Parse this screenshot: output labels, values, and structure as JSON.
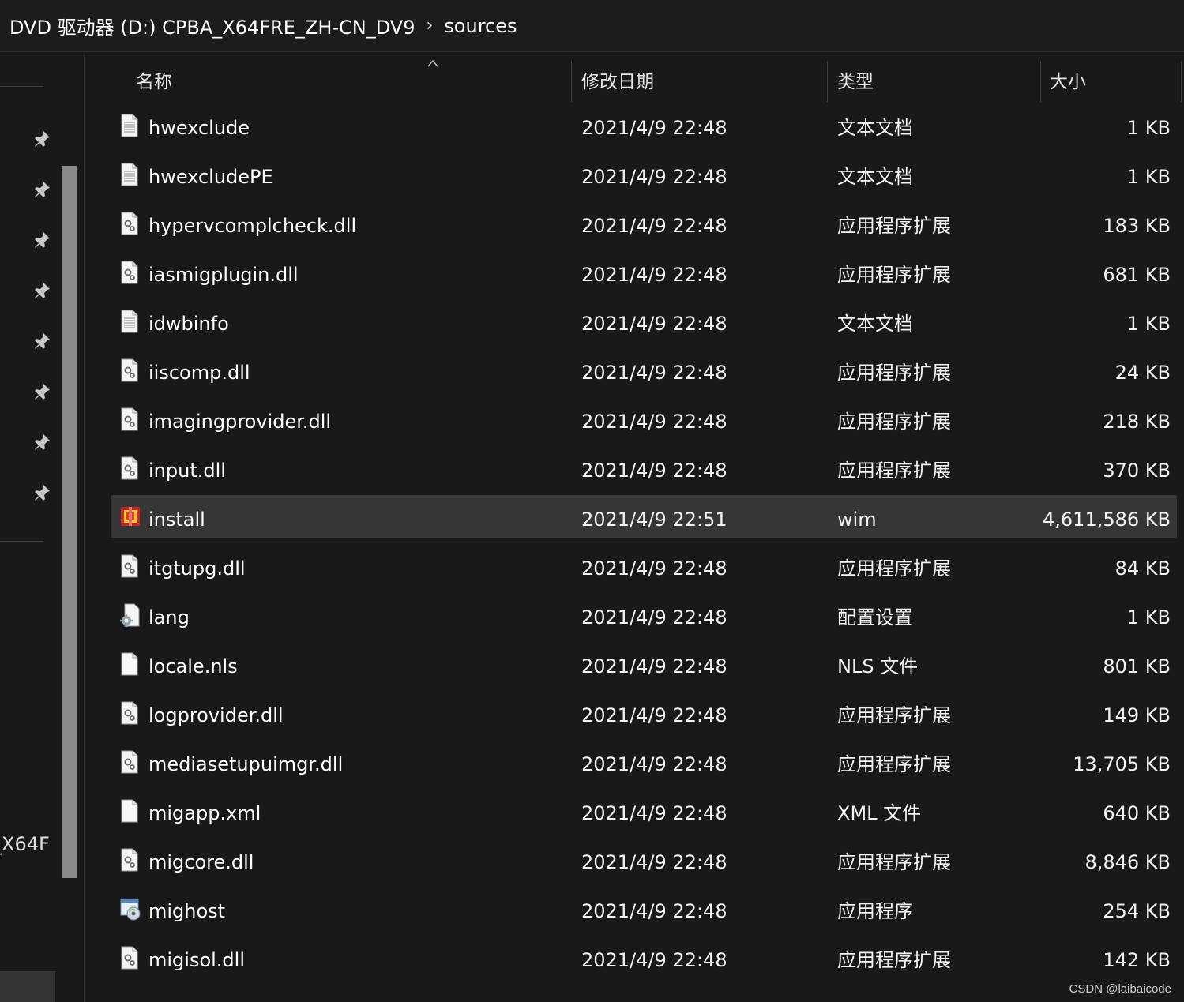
{
  "breadcrumb": {
    "drive": "DVD 驱动器 (D:) CPBA_X64FRE_ZH-CN_DV9",
    "separator": "›",
    "folder": "sources"
  },
  "nav_pane": {
    "pinned_icon": "pin-icon",
    "pinned_count": 8,
    "truncated_label": "_X64F"
  },
  "columns": {
    "name": "名称",
    "date": "修改日期",
    "type": "类型",
    "size": "大小",
    "sort_icon": "sort-ascending-icon"
  },
  "files": [
    {
      "name": "hwexclude",
      "date": "2021/4/9 22:48",
      "type": "文本文档",
      "size": "1 KB",
      "icon": "text-document-icon",
      "selected": false
    },
    {
      "name": "hwexcludePE",
      "date": "2021/4/9 22:48",
      "type": "文本文档",
      "size": "1 KB",
      "icon": "text-document-icon",
      "selected": false
    },
    {
      "name": "hypervcomplcheck.dll",
      "date": "2021/4/9 22:48",
      "type": "应用程序扩展",
      "size": "183 KB",
      "icon": "dll-file-icon",
      "selected": false
    },
    {
      "name": "iasmigplugin.dll",
      "date": "2021/4/9 22:48",
      "type": "应用程序扩展",
      "size": "681 KB",
      "icon": "dll-file-icon",
      "selected": false
    },
    {
      "name": "idwbinfo",
      "date": "2021/4/9 22:48",
      "type": "文本文档",
      "size": "1 KB",
      "icon": "text-document-icon",
      "selected": false
    },
    {
      "name": "iiscomp.dll",
      "date": "2021/4/9 22:48",
      "type": "应用程序扩展",
      "size": "24 KB",
      "icon": "dll-file-icon",
      "selected": false
    },
    {
      "name": "imagingprovider.dll",
      "date": "2021/4/9 22:48",
      "type": "应用程序扩展",
      "size": "218 KB",
      "icon": "dll-file-icon",
      "selected": false
    },
    {
      "name": "input.dll",
      "date": "2021/4/9 22:48",
      "type": "应用程序扩展",
      "size": "370 KB",
      "icon": "dll-file-icon",
      "selected": false
    },
    {
      "name": "install",
      "date": "2021/4/9 22:51",
      "type": "wim",
      "size": "4,611,586 KB",
      "icon": "wim-archive-icon",
      "selected": true
    },
    {
      "name": "itgtupg.dll",
      "date": "2021/4/9 22:48",
      "type": "应用程序扩展",
      "size": "84 KB",
      "icon": "dll-file-icon",
      "selected": false
    },
    {
      "name": "lang",
      "date": "2021/4/9 22:48",
      "type": "配置设置",
      "size": "1 KB",
      "icon": "config-settings-icon",
      "selected": false
    },
    {
      "name": "locale.nls",
      "date": "2021/4/9 22:48",
      "type": "NLS 文件",
      "size": "801 KB",
      "icon": "blank-file-icon",
      "selected": false
    },
    {
      "name": "logprovider.dll",
      "date": "2021/4/9 22:48",
      "type": "应用程序扩展",
      "size": "149 KB",
      "icon": "dll-file-icon",
      "selected": false
    },
    {
      "name": "mediasetupuimgr.dll",
      "date": "2021/4/9 22:48",
      "type": "应用程序扩展",
      "size": "13,705 KB",
      "icon": "dll-file-icon",
      "selected": false
    },
    {
      "name": "migapp.xml",
      "date": "2021/4/9 22:48",
      "type": "XML 文件",
      "size": "640 KB",
      "icon": "blank-file-icon",
      "selected": false
    },
    {
      "name": "migcore.dll",
      "date": "2021/4/9 22:48",
      "type": "应用程序扩展",
      "size": "8,846 KB",
      "icon": "dll-file-icon",
      "selected": false
    },
    {
      "name": "mighost",
      "date": "2021/4/9 22:48",
      "type": "应用程序",
      "size": "254 KB",
      "icon": "application-exe-icon",
      "selected": false
    },
    {
      "name": "migisol.dll",
      "date": "2021/4/9 22:48",
      "type": "应用程序扩展",
      "size": "142 KB",
      "icon": "dll-file-icon",
      "selected": false
    }
  ],
  "watermark": "CSDN @laibaicode"
}
